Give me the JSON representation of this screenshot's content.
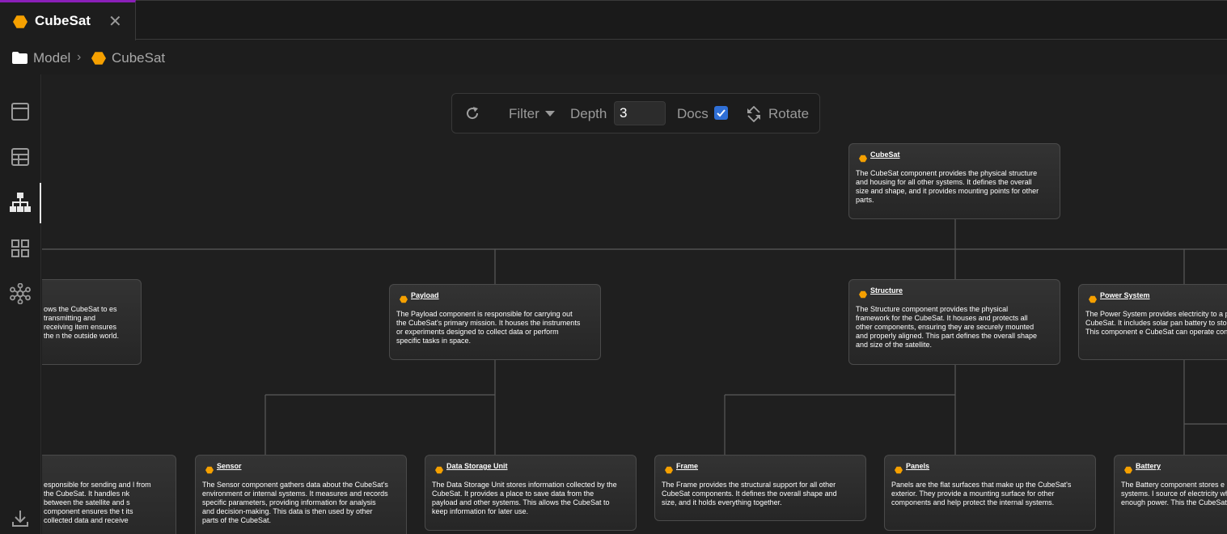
{
  "tab": {
    "title": "CubeSat",
    "close": "✕"
  },
  "breadcrumb": {
    "root": "Model",
    "separator": "›",
    "current": "CubeSat"
  },
  "sidebar": {
    "items": [
      {
        "name": "panel-view",
        "icon": "window-icon"
      },
      {
        "name": "table-view",
        "icon": "table-icon"
      },
      {
        "name": "hierarchy-view",
        "icon": "hierarchy-icon",
        "active": true
      },
      {
        "name": "grid-view",
        "icon": "grid-icon"
      },
      {
        "name": "network-view",
        "icon": "network-icon"
      },
      {
        "name": "download",
        "icon": "download-icon"
      }
    ]
  },
  "toolbar": {
    "filter_label": "Filter",
    "depth_label": "Depth",
    "depth_value": "3",
    "docs_label": "Docs",
    "docs_checked": true,
    "rotate_label": "Rotate"
  },
  "colors": {
    "accent_hex": "#f5a000",
    "tab_accent": "#8a1fb8",
    "checkbox": "#2f6fd6"
  },
  "nodes": {
    "cubesat": {
      "title": "CubeSat",
      "desc": "The CubeSat component provides the physical structure and housing for all other systems. It defines the overall size and shape, and it provides mounting points for other parts."
    },
    "communication": {
      "title": "",
      "desc": "ows the CubeSat to es transmitting and receiving item ensures the n the outside world."
    },
    "payload": {
      "title": "Payload",
      "desc": "The Payload component is responsible for carrying out the CubeSat's primary mission. It houses the instruments or experiments designed to collect data or perform specific tasks in space."
    },
    "structure": {
      "title": "Structure",
      "desc": "The Structure component provides the physical framework for the CubeSat. It houses and protects all other components, ensuring they are securely mounted and properly aligned. This part defines the overall shape and size of the satellite."
    },
    "power_system": {
      "title": "Power System",
      "desc": "The Power System provides electricity to a parts of the CubeSat. It includes solar pan battery to store energy. This component e CubeSat can operate continuously."
    },
    "transceiver": {
      "title": "",
      "desc": "esponsible for sending and l from the CubeSat. It handles nk between the satellite and s component ensures the t its collected data and receive"
    },
    "sensor": {
      "title": "Sensor",
      "desc": "The Sensor component gathers data about the CubeSat's environment or internal systems. It measures and records specific parameters, providing information for analysis and decision-making. This data is then used by other parts of the CubeSat."
    },
    "data_storage": {
      "title": "Data Storage Unit",
      "desc": "The Data Storage Unit stores information collected by the CubeSat. It provides a place to save data from the payload and other systems. This allows the CubeSat to keep information for later use."
    },
    "frame": {
      "title": "Frame",
      "desc": "The Frame provides the structural support for all other CubeSat components. It defines the overall shape and size, and it holds everything together."
    },
    "panels": {
      "title": "Panels",
      "desc": "Panels are the flat surfaces that make up the CubeSat's exterior. They provide a mounting surface for other components and help protect the internal systems."
    },
    "battery": {
      "title": "Battery",
      "desc": "The Battery component stores e power the CubeSat's systems. I source of electricity when solar generating enough power. This the CubeSat's continuous oper"
    }
  }
}
